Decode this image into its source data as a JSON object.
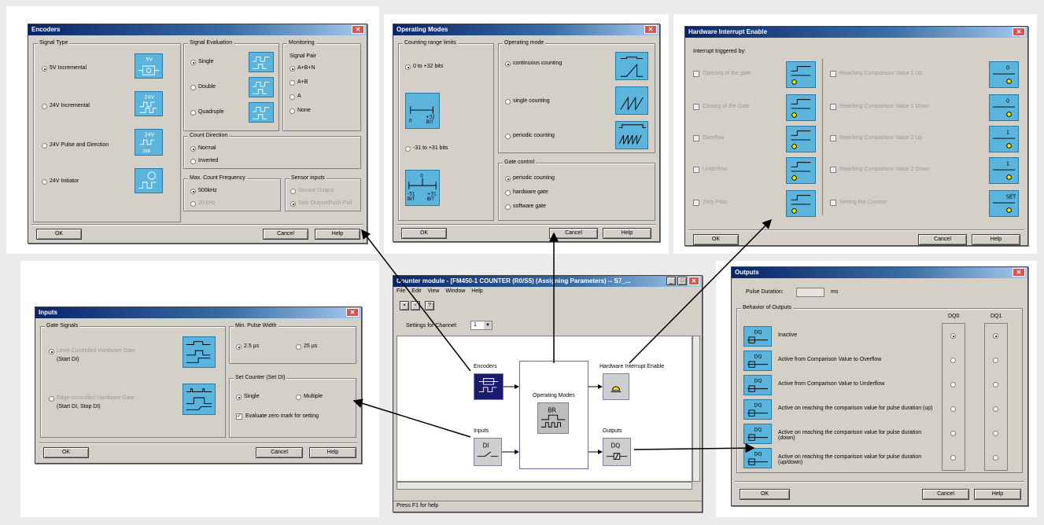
{
  "encoders": {
    "title": "Encoders",
    "signal_type": {
      "legend": "Signal Type",
      "options": [
        "5V Incremental",
        "24V Incremental",
        "24V Pulse and Direction",
        "24V Initiator"
      ]
    },
    "signal_eval": {
      "legend": "Signal Evaluation",
      "options": [
        "Single",
        "Double",
        "Quadruple"
      ]
    },
    "monitoring": {
      "legend": "Monitoring",
      "sublabel": "Signal Pair",
      "options": [
        "A+B+N",
        "A+B",
        "A",
        "None"
      ]
    },
    "count_dir": {
      "legend": "Count Direction",
      "options": [
        "Normal",
        "Inverted"
      ]
    },
    "max_freq": {
      "legend": "Max. Count Frequency",
      "options": [
        "500kHz",
        "20 kHz"
      ]
    },
    "sensor": {
      "legend": "Sensor inputs",
      "options": [
        "Source Output",
        "Sink Output/Push-Pull"
      ]
    },
    "icons": {
      "i1": "5V",
      "i2": "24V",
      "i3": "24V",
      "i3b": "DIR"
    },
    "ok": "OK",
    "cancel": "Cancel",
    "help": "Help"
  },
  "opmodes": {
    "title": "Operating Modes",
    "range": {
      "legend": "Counting range limits",
      "options": [
        "0 to +32 bits",
        "-31 to +31 bits"
      ],
      "icon1": [
        "0",
        "+32",
        "BIT"
      ],
      "icon2": [
        "-31",
        "+31",
        "BIT",
        "BIT",
        "0"
      ]
    },
    "mode": {
      "legend": "Operating mode",
      "options": [
        "continuous counting",
        "single counting",
        "periodic counting"
      ]
    },
    "gate": {
      "legend": "Gate control",
      "options": [
        "periodic counting",
        "hardware gate",
        "software gate"
      ]
    },
    "ok": "OK",
    "cancel": "Cancel",
    "help": "Help"
  },
  "hwint": {
    "title": "Hardware Interrupt Enable",
    "heading": "Interrupt triggered by:",
    "left": [
      "Opening of the gate",
      "Closing of the Gate",
      "Overflow",
      "Underflow",
      "Zero Pass"
    ],
    "right": [
      "Reaching Comparison Value 1 Up",
      "Reaching Comparison Value 1 Down",
      "Reaching Comparison Value 2 Up",
      "Reaching Comparison Value 2 Down",
      "Setting the Counter"
    ],
    "icon_digits": [
      "0",
      "0",
      "1",
      "1",
      "SET"
    ],
    "ok": "OK",
    "cancel": "Cancel",
    "help": "Help"
  },
  "inputs": {
    "title": "Inputs",
    "gate": {
      "legend": "Gate Signals",
      "opt1": "Level Controlled Hardware Gate",
      "opt1b": "(Start DI)",
      "opt2": "Edge-controlled Hardware Gate",
      "opt2b": "(Start DI, Stop DI)"
    },
    "pulse": {
      "legend": "Min. Pulse Width",
      "options": [
        "2.5 µs",
        "25 µs"
      ]
    },
    "setc": {
      "legend": "Set Counter (Set DI)",
      "options": [
        "Single",
        "Multiple"
      ],
      "check": "Evaluate zero mark for setting"
    },
    "ok": "OK",
    "cancel": "Cancel",
    "help": "Help"
  },
  "main": {
    "title": "Counter module - [FM450-1 COUNTER (R0/S5) (Assigning Parameters) -- S7_...",
    "menu": [
      "File",
      "Edit",
      "View",
      "Window",
      "Help"
    ],
    "channel_label": "Settings for Channel:",
    "channel_value": "1",
    "blocks": {
      "encoders": "Encoders",
      "opmodes": "Operating Modes",
      "hwint": "Hardware Interrupt Enable",
      "inputs": "Inputs",
      "outputs": "Outputs"
    },
    "op_icon": "BR",
    "inputs_icon": "DI",
    "outputs_icon": "DQ",
    "status": "Press F1 for help"
  },
  "outputs": {
    "title": "Outputs",
    "pulse_label": "Pulse Duration:",
    "pulse_unit": "ms",
    "behavior_legend": "Behavior of Outputs",
    "col1": "DQ0",
    "col2": "DQ1",
    "rows": [
      "Inactive",
      "Active from Comparison Value to Overflow",
      "Active from Comparison Value to Underflow",
      "Active on reaching the comparison value for pulse duration (up)",
      "Active on reaching the comparison value for pulse duration (down)",
      "Active on reaching the comparison value for pulse duration (up/down)"
    ],
    "icon_text": "DQ",
    "ok": "OK",
    "cancel": "Cancel",
    "help": "Help"
  }
}
